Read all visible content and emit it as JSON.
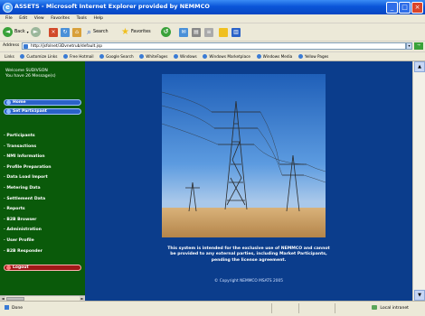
{
  "window": {
    "title": "ASSETS - Microsoft Internet Explorer provided by NEMMCO"
  },
  "menubar": [
    "File",
    "Edit",
    "View",
    "Favorites",
    "Tools",
    "Help"
  ],
  "toolbar": {
    "back": "Back",
    "search": "Search",
    "favorites": "Favorites"
  },
  "address": {
    "label": "Address",
    "url": "http://jsfolnet/3Dvnetrub/default.jsp"
  },
  "links": [
    "Links",
    "Customize Links",
    "Free Hotmail",
    "Google Search",
    "WhiteFages",
    "Windows",
    "Windows Marketplace",
    "Windows Media",
    "Yellow Pages"
  ],
  "sidebar": {
    "welcome_line1": "Welcome SUDIVSON",
    "welcome_line2": "You have 26 Message(s)",
    "home": "Home",
    "set_participant": "Set Participant",
    "menu": [
      "Participants",
      "Transactions",
      "NMI Information",
      "Profile Preparation",
      "Data Load Import",
      "Metering Data",
      "Settlement Data",
      "Reports",
      "B2B Browser",
      "Administration",
      "User Profile",
      "B2B Responder"
    ],
    "logout": "Logout"
  },
  "main": {
    "notice_1": "This system is intended for the exclusive use of NEMMCO and cannot",
    "notice_2": "be provided to any external parties, including Market Participants,",
    "notice_3": "pending the license agreement.",
    "copyright": "© Copyright NEMMCO MSATS 2005"
  },
  "status": {
    "left": "Done",
    "right": "Local intranet"
  }
}
